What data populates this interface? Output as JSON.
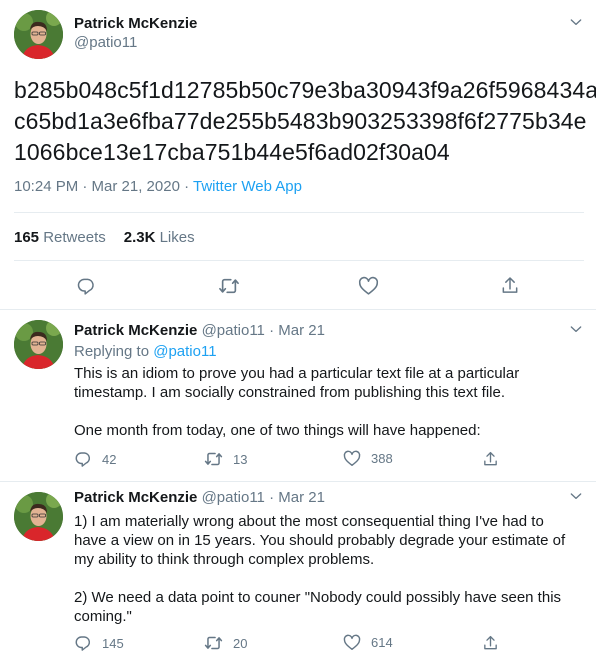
{
  "main_tweet": {
    "author_name": "Patrick McKenzie",
    "author_handle": "@patio11",
    "text_lines": [
      "b285b048c5f1d12785b50c79e3ba30943f9a26f5968434a",
      "c65bd1a3e6fba77de255b5483b903253398f6f2775b34e",
      "1066bce13e17cba751b44e5f6ad02f30a04"
    ],
    "timestamp": "10:24 PM · Mar 21, 2020",
    "separator": " · ",
    "source": "Twitter Web App",
    "retweets_count": "165",
    "retweets_label": "Retweets",
    "likes_count": "2.3K",
    "likes_label": "Likes"
  },
  "replies": [
    {
      "author_name": "Patrick McKenzie",
      "author_handle": "@patio11",
      "date": "· Mar 21",
      "replying_prefix": "Replying to",
      "replying_handle": "@patio11",
      "paragraphs": [
        "This is an idiom to prove you had a particular text file at a particular timestamp. I am socially constrained from publishing this text file.",
        "One month from today, one of two things will have happened:"
      ],
      "reply_count": "42",
      "retweet_count": "13",
      "like_count": "388"
    },
    {
      "author_name": "Patrick McKenzie",
      "author_handle": "@patio11",
      "date": "· Mar 21",
      "paragraphs": [
        "1) I am materially wrong about the most consequential thing I've had to have a view on in 15 years. You should probably degrade your estimate of my ability to think through complex problems.",
        "2) We need a data point to couner \"Nobody could possibly have seen this coming.\""
      ],
      "reply_count": "145",
      "retweet_count": "20",
      "like_count": "614"
    }
  ],
  "colors": {
    "text": "#14171a",
    "secondary": "#657786",
    "link": "#1da1f2",
    "border": "#e6ecf0"
  },
  "icons": [
    "chevron-down-icon",
    "reply-icon",
    "retweet-icon",
    "like-icon",
    "share-icon"
  ]
}
